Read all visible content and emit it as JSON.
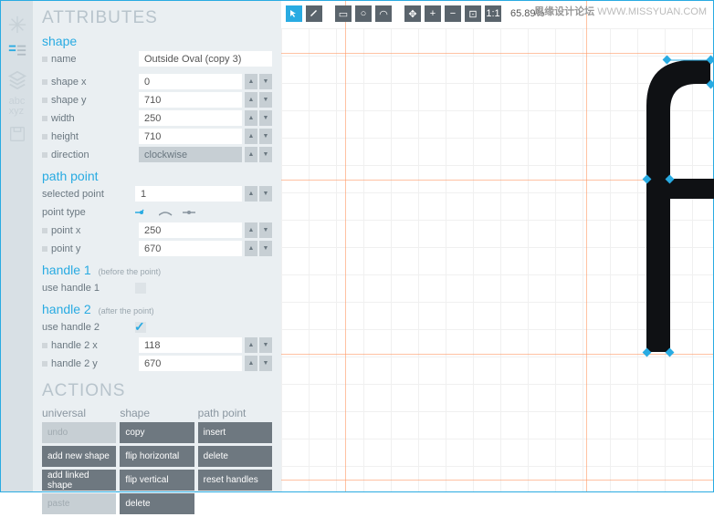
{
  "watermark": {
    "cn": "思缘设计论坛",
    "url": "WWW.MISSYUAN.COM"
  },
  "panel": {
    "header": "ATTRIBUTES",
    "shape": {
      "title": "shape",
      "name_label": "name",
      "name_value": "Outside Oval (copy 3)",
      "shape_x_label": "shape x",
      "shape_x_value": "0",
      "shape_y_label": "shape y",
      "shape_y_value": "710",
      "width_label": "width",
      "width_value": "250",
      "height_label": "height",
      "height_value": "710",
      "direction_label": "direction",
      "direction_value": "clockwise"
    },
    "path_point": {
      "title": "path point",
      "selected_label": "selected point",
      "selected_value": "1",
      "type_label": "point type",
      "point_x_label": "point x",
      "point_x_value": "250",
      "point_y_label": "point y",
      "point_y_value": "670"
    },
    "handle1": {
      "title": "handle 1",
      "note": "(before the point)",
      "use_label": "use handle 1"
    },
    "handle2": {
      "title": "handle 2",
      "note": "(after the point)",
      "use_label": "use handle 2",
      "x_label": "handle 2 x",
      "x_value": "118",
      "y_label": "handle 2 y",
      "y_value": "670"
    },
    "actions": {
      "header": "ACTIONS",
      "universal": {
        "title": "universal",
        "undo": "undo",
        "add_shape": "add new shape",
        "add_linked": "add linked shape",
        "paste": "paste"
      },
      "shape": {
        "title": "shape",
        "copy": "copy",
        "flip_h": "flip horizontal",
        "flip_v": "flip vertical",
        "delete": "delete"
      },
      "path_point": {
        "title": "path point",
        "insert": "insert",
        "delete": "delete",
        "reset": "reset handles"
      }
    }
  },
  "toolbar": {
    "zoom": "65.89%"
  }
}
